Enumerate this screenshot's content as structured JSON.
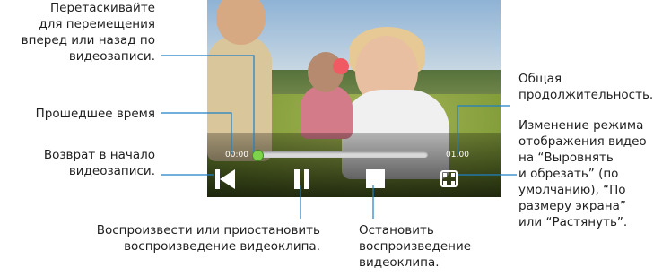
{
  "annotations": {
    "seek": "Перетаскивайте\nдля перемещения\nвперед или назад по\nвидеозаписи.",
    "elapsed": "Прошедшее время",
    "restart": "Возврат в начало\nвидеозаписи.",
    "play_pause": "Воспроизвести или приостановить\nвоспроизведение видеоклипа.",
    "stop": "Остановить\nвоспроизведение\nвидеоклипа.",
    "total": "Общая\nпродолжительность.",
    "display_mode": "Изменение режима\nотображения видео\nна “Выровнять\nи обрезать” (по\nумолчанию), “По\nразмеру экрана”\nили “Растянуть”."
  },
  "player": {
    "time_elapsed": "00:00",
    "time_total": "01:00",
    "progress_fraction": 0.0
  },
  "icons": {
    "restart": "skip-to-start-icon",
    "pause": "pause-icon",
    "stop": "stop-icon",
    "display_mode": "display-mode-icon"
  },
  "colors": {
    "leader_line": "#1f7fc4",
    "progress": "#5fbf3a"
  }
}
